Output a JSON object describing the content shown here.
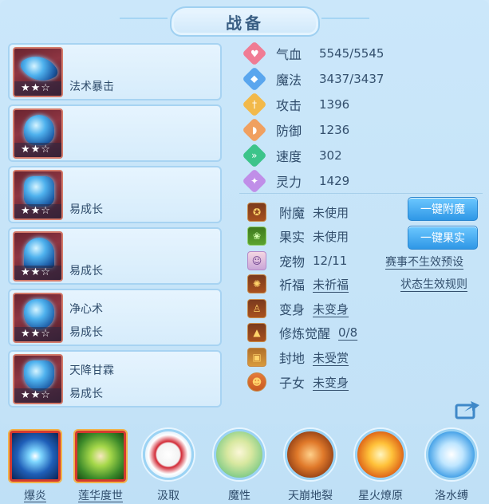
{
  "header": {
    "title": "战备"
  },
  "equipment": [
    {
      "stars": "★★☆",
      "line1": "",
      "line2": "法术暴击"
    },
    {
      "stars": "★★☆",
      "line1": "",
      "line2": ""
    },
    {
      "stars": "★★☆",
      "line1": "",
      "line2": "易成长"
    },
    {
      "stars": "★★☆",
      "line1": "",
      "line2": "易成长"
    },
    {
      "stars": "★★☆",
      "line1": "净心术",
      "line2": "易成长"
    },
    {
      "stars": "★★☆",
      "line1": "天降甘霖",
      "line2": "易成长"
    }
  ],
  "stats": [
    {
      "label": "气血",
      "value": "5545/5545",
      "icon": "heart-icon",
      "color": "#f07c94",
      "glyph": "♥"
    },
    {
      "label": "魔法",
      "value": "3437/3437",
      "icon": "mana-icon",
      "color": "#5aa6ee",
      "glyph": "◆"
    },
    {
      "label": "攻击",
      "value": "1396",
      "icon": "sword-icon",
      "color": "#f2b94a",
      "glyph": "†"
    },
    {
      "label": "防御",
      "value": "1236",
      "icon": "shield-icon",
      "color": "#f0a060",
      "glyph": "◗"
    },
    {
      "label": "速度",
      "value": "302",
      "icon": "speed-icon",
      "color": "#3cc48a",
      "glyph": "»"
    },
    {
      "label": "灵力",
      "value": "1429",
      "icon": "spirit-icon",
      "color": "#c08ee8",
      "glyph": "✦"
    }
  ],
  "features": [
    {
      "label": "附魔",
      "value": "未使用",
      "underline": false,
      "icon": "enchant-icon",
      "glyph": "✪"
    },
    {
      "label": "果实",
      "value": "未使用",
      "underline": false,
      "icon": "fruit-icon",
      "glyph": "❀"
    },
    {
      "label": "宠物",
      "value": "12/11",
      "underline": false,
      "icon": "pet-icon",
      "glyph": "☺"
    },
    {
      "label": "祈福",
      "value": "未祈福",
      "underline": true,
      "icon": "blessing-icon",
      "glyph": "✺"
    },
    {
      "label": "变身",
      "value": "未变身",
      "underline": true,
      "icon": "transform-icon",
      "glyph": "♙"
    },
    {
      "label": "修炼觉醒",
      "value": "0/8",
      "underline": true,
      "icon": "cultivate-icon",
      "glyph": "▲"
    },
    {
      "label": "封地",
      "value": "未受赏",
      "underline": true,
      "icon": "fief-icon",
      "glyph": "▣"
    },
    {
      "label": "子女",
      "value": "未变身",
      "underline": true,
      "icon": "child-icon",
      "glyph": "☻"
    }
  ],
  "buttons": {
    "enchant": "一键附魔",
    "fruit": "一键果实"
  },
  "links": {
    "match": "赛事不生效预设",
    "rules": "状态生效规则"
  },
  "skills": [
    {
      "label": "爆炎",
      "style": "square",
      "underline": true,
      "icon": "burst-flame-icon"
    },
    {
      "label": "莲华度世",
      "style": "square",
      "underline": true,
      "icon": "lotus-hand-icon"
    },
    {
      "label": "汲取",
      "style": "disc",
      "underline": false,
      "icon": "absorb-icon"
    },
    {
      "label": "魔性",
      "style": "disc",
      "underline": false,
      "icon": "demonic-icon"
    },
    {
      "label": "天崩地裂",
      "style": "disc",
      "underline": false,
      "icon": "earthquake-icon"
    },
    {
      "label": "星火燎原",
      "style": "disc",
      "underline": false,
      "icon": "spark-fire-icon"
    },
    {
      "label": "洛水缚",
      "style": "disc",
      "underline": false,
      "icon": "water-bind-icon"
    }
  ]
}
